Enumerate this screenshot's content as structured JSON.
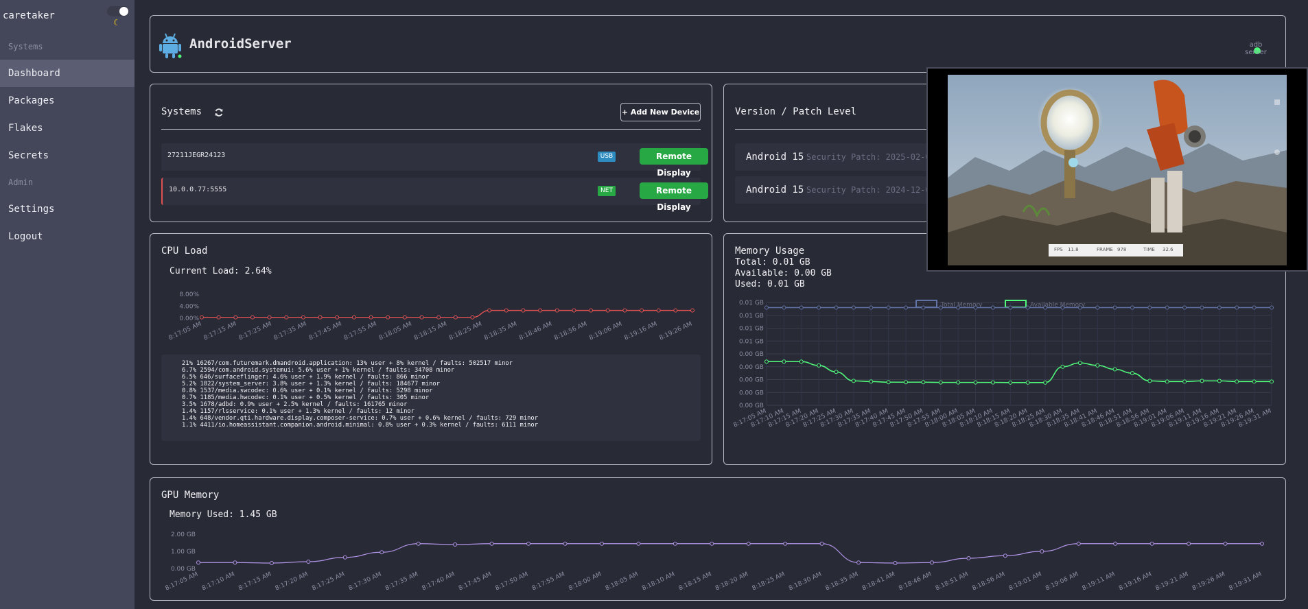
{
  "sidebar": {
    "brand": "caretaker",
    "sections": [
      "Systems",
      "Admin"
    ],
    "items": [
      "Dashboard",
      "Packages",
      "Flakes",
      "Secrets",
      "Settings",
      "Logout"
    ],
    "active": "Dashboard"
  },
  "header": {
    "title": "AndroidServer",
    "status_line1": "adb",
    "status_line2": "server",
    "status_color": "#50fa7b"
  },
  "systems": {
    "title": "Systems",
    "add_button": "+ Add New Device",
    "devices": [
      {
        "id": "27211JEGR24123",
        "badge": "USB",
        "badge_color": "#2e8bc0",
        "button": "Remote Display"
      },
      {
        "id": "10.0.0.77:5555",
        "badge": "NET",
        "badge_color": "#27a844",
        "button": "Remote Display"
      }
    ]
  },
  "version": {
    "title": "Version / Patch Level",
    "rows": [
      {
        "name": "Android 15",
        "patch": "Security Patch: 2025-02-0"
      },
      {
        "name": "Android 15",
        "patch": "Security Patch: 2024-12-0"
      }
    ]
  },
  "cpu": {
    "title": "CPU Load",
    "current": "Current Load: 2.64%",
    "processes": [
      "21% 16267/com.futuremark.dmandroid.application: 13% user + 8% kernel / faults: 502517 minor",
      "6.7% 2594/com.android.systemui: 5.6% user + 1% kernel / faults: 34708 minor",
      "6.5% 646/surfaceflinger: 4.6% user + 1.9% kernel / faults: 866 minor",
      "5.2% 1822/system_server: 3.8% user + 1.3% kernel / faults: 184677 minor",
      "0.8% 1537/media.swcodec: 0.6% user + 0.1% kernel / faults: 5298 minor",
      "0.7% 1185/media.hwcodec: 0.1% user + 0.5% kernel / faults: 305 minor",
      "3.5% 1678/adbd: 0.9% user + 2.5% kernel / faults: 161765 minor",
      "1.4% 1157/rlsservice: 0.1% user + 1.3% kernel / faults: 12 minor",
      "1.4% 648/vendor.qti.hardware.display.composer-service: 0.7% user + 0.6% kernel / faults: 729 minor",
      "1.1% 4411/io.homeassistant.companion.android.minimal: 0.8% user + 0.3% kernel / faults: 6111 minor"
    ]
  },
  "memory": {
    "title": "Memory Usage",
    "total": "Total: 0.01 GB",
    "available": "Available: 0.00 GB",
    "used": "Used: 0.01 GB"
  },
  "gpu": {
    "title": "GPU Memory",
    "used": "Memory Used: 1.45 GB"
  },
  "overlay": {
    "hud": {
      "fps_label": "FPS",
      "fps": "11.8",
      "frame_label": "FRAME",
      "frame": "978",
      "time_label": "TIME",
      "time": "32.6"
    }
  },
  "chart_data": [
    {
      "type": "line",
      "name": "cpu-load",
      "x": [
        "8:17:05 AM",
        "8:17:10 AM",
        "8:17:15 AM",
        "8:17:20 AM",
        "8:17:25 AM",
        "8:17:30 AM",
        "8:17:35 AM",
        "8:17:40 AM",
        "8:17:45 AM",
        "8:17:50 AM",
        "8:17:55 AM",
        "8:18:00 AM",
        "8:18:05 AM",
        "8:18:10 AM",
        "8:18:15 AM",
        "8:18:20 AM",
        "8:18:25 AM",
        "8:18:30 AM",
        "8:18:35 AM",
        "8:18:40 AM",
        "8:18:46 AM",
        "8:18:51 AM",
        "8:18:56 AM",
        "8:19:01 AM",
        "8:19:06 AM",
        "8:19:11 AM",
        "8:19:16 AM",
        "8:19:21 AM",
        "8:19:26 AM",
        "8:19:31 AM"
      ],
      "x_tick_labels": [
        "8:17:05 AM",
        "8:17:15 AM",
        "8:17:25 AM",
        "8:17:35 AM",
        "8:17:45 AM",
        "8:17:55 AM",
        "8:18:05 AM",
        "8:18:15 AM",
        "8:18:25 AM",
        "8:18:35 AM",
        "8:18:46 AM",
        "8:18:56 AM",
        "8:19:06 AM",
        "8:19:16 AM",
        "8:19:26 AM"
      ],
      "y_tick_labels": [
        "8.00%",
        "4.00%",
        "0.00%"
      ],
      "ylim": [
        0,
        8
      ],
      "series": [
        {
          "color": "#e05252",
          "values": [
            0.3,
            0.3,
            0.3,
            0.3,
            0.3,
            0.3,
            0.3,
            0.3,
            0.3,
            0.3,
            0.3,
            0.3,
            0.3,
            0.3,
            0.3,
            0.3,
            0.3,
            2.6,
            2.6,
            2.6,
            2.6,
            2.6,
            2.6,
            2.6,
            2.6,
            2.6,
            2.6,
            2.6,
            2.6,
            2.6
          ]
        }
      ],
      "grid": false
    },
    {
      "type": "line",
      "name": "memory-usage",
      "x": [
        "8:17:05 AM",
        "8:17:10 AM",
        "8:17:15 AM",
        "8:17:20 AM",
        "8:17:25 AM",
        "8:17:30 AM",
        "8:17:35 AM",
        "8:17:40 AM",
        "8:17:45 AM",
        "8:17:50 AM",
        "8:17:55 AM",
        "8:18:00 AM",
        "8:18:05 AM",
        "8:18:10 AM",
        "8:18:15 AM",
        "8:18:20 AM",
        "8:18:25 AM",
        "8:18:30 AM",
        "8:18:35 AM",
        "8:18:41 AM",
        "8:18:46 AM",
        "8:18:51 AM",
        "8:18:56 AM",
        "8:19:01 AM",
        "8:19:06 AM",
        "8:19:11 AM",
        "8:19:16 AM",
        "8:19:21 AM",
        "8:19:26 AM",
        "8:19:31 AM"
      ],
      "y_tick_labels": [
        "0.01 GB",
        "0.01 GB",
        "0.01 GB",
        "0.01 GB",
        "0.00 GB",
        "0.00 GB",
        "0.00 GB",
        "0.00 GB",
        "0.00 GB"
      ],
      "ylim": [
        0,
        8
      ],
      "legend": [
        "Total Memory",
        "Available Memory"
      ],
      "legend_position": "top-center",
      "series": [
        {
          "name": "Total Memory",
          "color": "#6272a4",
          "values": [
            7.6,
            7.6,
            7.6,
            7.6,
            7.6,
            7.6,
            7.6,
            7.6,
            7.6,
            7.6,
            7.6,
            7.6,
            7.6,
            7.6,
            7.6,
            7.6,
            7.6,
            7.6,
            7.6,
            7.6,
            7.6,
            7.6,
            7.6,
            7.6,
            7.6,
            7.6,
            7.6,
            7.6,
            7.6,
            7.6
          ]
        },
        {
          "name": "Available Memory",
          "color": "#50fa7b",
          "values": [
            3.4,
            3.4,
            3.4,
            3.1,
            2.6,
            1.9,
            1.85,
            1.8,
            1.8,
            1.8,
            1.78,
            1.78,
            1.78,
            1.78,
            1.77,
            1.77,
            1.77,
            3.0,
            3.3,
            3.1,
            2.8,
            2.5,
            1.9,
            1.85,
            1.85,
            1.9,
            1.9,
            1.85,
            1.85,
            1.85
          ]
        }
      ],
      "grid": true
    },
    {
      "type": "line",
      "name": "gpu-memory",
      "x": [
        "8:17:05 AM",
        "8:17:10 AM",
        "8:17:15 AM",
        "8:17:20 AM",
        "8:17:25 AM",
        "8:17:30 AM",
        "8:17:35 AM",
        "8:17:40 AM",
        "8:17:45 AM",
        "8:17:50 AM",
        "8:17:55 AM",
        "8:18:00 AM",
        "8:18:05 AM",
        "8:18:10 AM",
        "8:18:15 AM",
        "8:18:20 AM",
        "8:18:25 AM",
        "8:18:30 AM",
        "8:18:35 AM",
        "8:18:41 AM",
        "8:18:46 AM",
        "8:18:51 AM",
        "8:18:56 AM",
        "8:19:01 AM",
        "8:19:06 AM",
        "8:19:11 AM",
        "8:19:16 AM",
        "8:19:21 AM",
        "8:19:26 AM",
        "8:19:31 AM"
      ],
      "y_tick_labels": [
        "2.00 GB",
        "1.00 GB",
        "0.00 GB"
      ],
      "ylim": [
        0,
        2
      ],
      "series": [
        {
          "color": "#b294e8",
          "values": [
            0.35,
            0.35,
            0.32,
            0.4,
            0.65,
            0.95,
            1.45,
            1.4,
            1.45,
            1.45,
            1.45,
            1.45,
            1.45,
            1.45,
            1.45,
            1.45,
            1.45,
            1.45,
            0.35,
            0.32,
            0.35,
            0.6,
            0.75,
            1.0,
            1.45,
            1.45,
            1.45,
            1.45,
            1.45,
            1.45
          ]
        }
      ],
      "grid": false
    }
  ]
}
